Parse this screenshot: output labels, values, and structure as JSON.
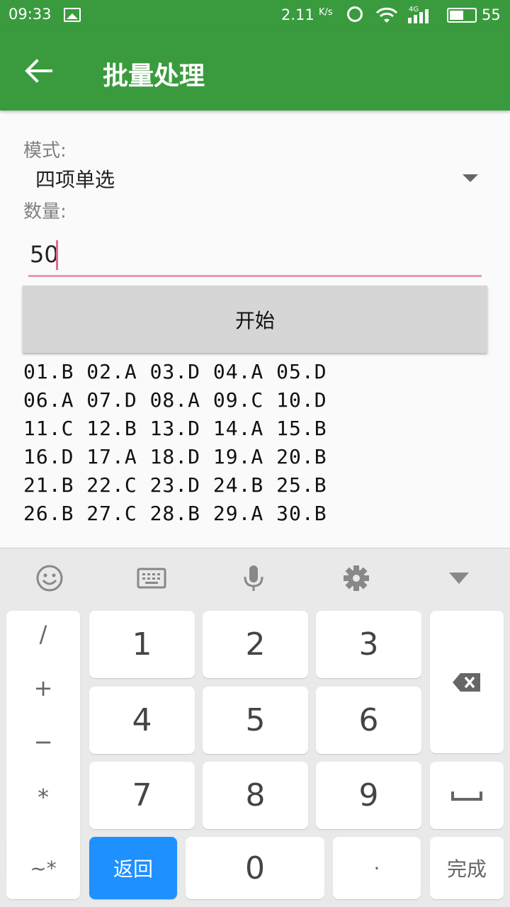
{
  "status_bar": {
    "time": "09:33",
    "net_speed": "2.11",
    "net_unit": "K/s",
    "network": "4G",
    "battery": "55",
    "battery_level": 0.55
  },
  "toolbar": {
    "title": "批量处理"
  },
  "form": {
    "mode_label": "模式:",
    "mode_value": "四项单选",
    "count_label": "数量:",
    "count_value": "50",
    "start_label": "开始"
  },
  "results": [
    "01.B 02.A 03.D 04.A 05.D",
    "06.A 07.D 08.A 09.C 10.D",
    "11.C 12.B 13.D 14.A 15.B",
    "16.D 17.A 18.D 19.A 20.B",
    "21.B 22.C 23.D 24.B 25.B",
    "26.B 27.C 28.B 29.A 30.B"
  ],
  "keyboard": {
    "symbols": [
      "/",
      "+",
      "−",
      "*"
    ],
    "digits": [
      "1",
      "2",
      "3",
      "4",
      "5",
      "6",
      "7",
      "8",
      "9",
      "0"
    ],
    "symbol_switch": "~*",
    "back_label": "返回",
    "dot": "·",
    "done_label": "完成"
  },
  "colors": {
    "primary": "#3a9b3e",
    "accent": "#e79ab5",
    "key_blue": "#1e90ff"
  }
}
